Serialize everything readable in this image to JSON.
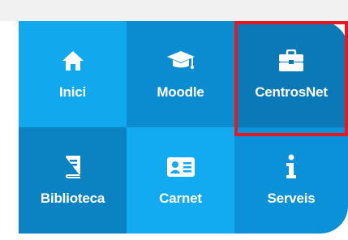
{
  "tiles": [
    {
      "label": "Inici",
      "icon": "home-icon"
    },
    {
      "label": "Moodle",
      "icon": "graduation-cap-icon"
    },
    {
      "label": "CentrosNet",
      "icon": "briefcase-icon"
    },
    {
      "label": "Biblioteca",
      "icon": "book-icon"
    },
    {
      "label": "Carnet",
      "icon": "id-card-icon"
    },
    {
      "label": "Serveis",
      "icon": "info-icon"
    }
  ],
  "colors": {
    "tile_light": "#12a8ee",
    "tile_mid": "#0b8cd1",
    "tile_dark": "#0a79b6",
    "highlight_border": "#e01b24",
    "icon_text": "#ffffff"
  }
}
